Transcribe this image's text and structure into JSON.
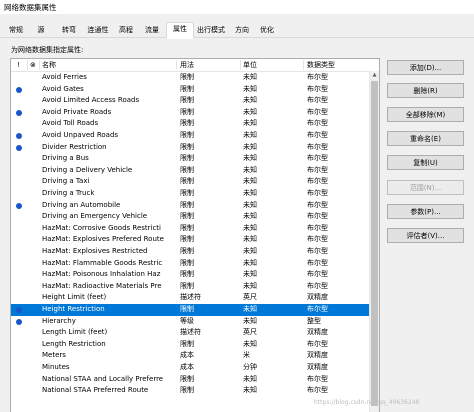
{
  "window": {
    "title": "网络数据集属性"
  },
  "tabs": [
    {
      "label": "常规",
      "active": false
    },
    {
      "label": "源",
      "active": false
    },
    {
      "label": "转弯",
      "active": false
    },
    {
      "label": "连通性",
      "active": false
    },
    {
      "label": "高程",
      "active": false
    },
    {
      "label": "流量",
      "active": false
    },
    {
      "label": "属性",
      "active": true
    },
    {
      "label": "出行模式",
      "active": false
    },
    {
      "label": "方向",
      "active": false
    },
    {
      "label": "优化",
      "active": false
    }
  ],
  "panel": {
    "label": "为网络数据集指定属性:"
  },
  "table": {
    "headers": {
      "warn": "!",
      "default": "⊗",
      "name": "名称",
      "usage": "用法",
      "unit": "单位",
      "dtype": "数据类型"
    },
    "rows": [
      {
        "name": "Avoid Ferries",
        "usage": "限制",
        "unit": "未知",
        "dtype": "布尔型",
        "marker": false
      },
      {
        "name": "Avoid Gates",
        "usage": "限制",
        "unit": "未知",
        "dtype": "布尔型",
        "marker": true
      },
      {
        "name": "Avoid Limited Access Roads",
        "usage": "限制",
        "unit": "未知",
        "dtype": "布尔型",
        "marker": false
      },
      {
        "name": "Avoid Private Roads",
        "usage": "限制",
        "unit": "未知",
        "dtype": "布尔型",
        "marker": true
      },
      {
        "name": "Avoid Toll Roads",
        "usage": "限制",
        "unit": "未知",
        "dtype": "布尔型",
        "marker": false
      },
      {
        "name": "Avoid Unpaved Roads",
        "usage": "限制",
        "unit": "未知",
        "dtype": "布尔型",
        "marker": true
      },
      {
        "name": "Divider Restriction",
        "usage": "限制",
        "unit": "未知",
        "dtype": "布尔型",
        "marker": true
      },
      {
        "name": "Driving a Bus",
        "usage": "限制",
        "unit": "未知",
        "dtype": "布尔型",
        "marker": false
      },
      {
        "name": "Driving a Delivery Vehicle",
        "usage": "限制",
        "unit": "未知",
        "dtype": "布尔型",
        "marker": false
      },
      {
        "name": "Driving a Taxi",
        "usage": "限制",
        "unit": "未知",
        "dtype": "布尔型",
        "marker": false
      },
      {
        "name": "Driving a Truck",
        "usage": "限制",
        "unit": "未知",
        "dtype": "布尔型",
        "marker": false
      },
      {
        "name": "Driving an Automobile",
        "usage": "限制",
        "unit": "未知",
        "dtype": "布尔型",
        "marker": true
      },
      {
        "name": "Driving an Emergency Vehicle",
        "usage": "限制",
        "unit": "未知",
        "dtype": "布尔型",
        "marker": false
      },
      {
        "name": "HazMat: Corrosive Goods Restricti",
        "usage": "限制",
        "unit": "未知",
        "dtype": "布尔型",
        "marker": false
      },
      {
        "name": "HazMat: Explosives Prefered Route",
        "usage": "限制",
        "unit": "未知",
        "dtype": "布尔型",
        "marker": false
      },
      {
        "name": "HazMat: Explosives Restricted",
        "usage": "限制",
        "unit": "未知",
        "dtype": "布尔型",
        "marker": false
      },
      {
        "name": "HazMat: Flammable Goods Restric",
        "usage": "限制",
        "unit": "未知",
        "dtype": "布尔型",
        "marker": false
      },
      {
        "name": "HazMat: Poisonous Inhalation Haz",
        "usage": "限制",
        "unit": "未知",
        "dtype": "布尔型",
        "marker": false
      },
      {
        "name": "HazMat: Radioactive Materials Pre",
        "usage": "限制",
        "unit": "未知",
        "dtype": "布尔型",
        "marker": false
      },
      {
        "name": "Height Limit (feet)",
        "usage": "描述符",
        "unit": "英尺",
        "dtype": "双精度",
        "marker": false
      },
      {
        "name": "Height Restriction",
        "usage": "限制",
        "unit": "未知",
        "dtype": "布尔型",
        "marker": true,
        "selected": true
      },
      {
        "name": "Hierarchy",
        "usage": "等级",
        "unit": "未知",
        "dtype": "整型",
        "marker": true
      },
      {
        "name": "Length Limit (feet)",
        "usage": "描述符",
        "unit": "英尺",
        "dtype": "双精度",
        "marker": false
      },
      {
        "name": "Length Restriction",
        "usage": "限制",
        "unit": "未知",
        "dtype": "布尔型",
        "marker": false
      },
      {
        "name": "Meters",
        "usage": "成本",
        "unit": "米",
        "dtype": "双精度",
        "marker": false
      },
      {
        "name": "Minutes",
        "usage": "成本",
        "unit": "分钟",
        "dtype": "双精度",
        "marker": false
      },
      {
        "name": "National STAA and Locally Preferre",
        "usage": "限制",
        "unit": "未知",
        "dtype": "布尔型",
        "marker": false
      },
      {
        "name": "National STAA Preferred Route",
        "usage": "限制",
        "unit": "未知",
        "dtype": "布尔型",
        "marker": false
      }
    ]
  },
  "buttons": [
    {
      "label": "添加(D)...",
      "name": "add-button",
      "enabled": true
    },
    {
      "label": "删除(R)",
      "name": "delete-button",
      "enabled": true
    },
    {
      "label": "全部移除(M)",
      "name": "remove-all-button",
      "enabled": true
    },
    {
      "label": "重命名(E)",
      "name": "rename-button",
      "enabled": true
    },
    {
      "label": "复制(U)",
      "name": "duplicate-button",
      "enabled": true
    },
    {
      "label": "范围(N)...",
      "name": "ranges-button",
      "enabled": false
    },
    {
      "label": "参数(P)...",
      "name": "parameters-button",
      "enabled": true
    },
    {
      "label": "评估者(V)...",
      "name": "evaluators-button",
      "enabled": true
    }
  ],
  "watermark": "https://blog.csdn.net/qq_40636248"
}
